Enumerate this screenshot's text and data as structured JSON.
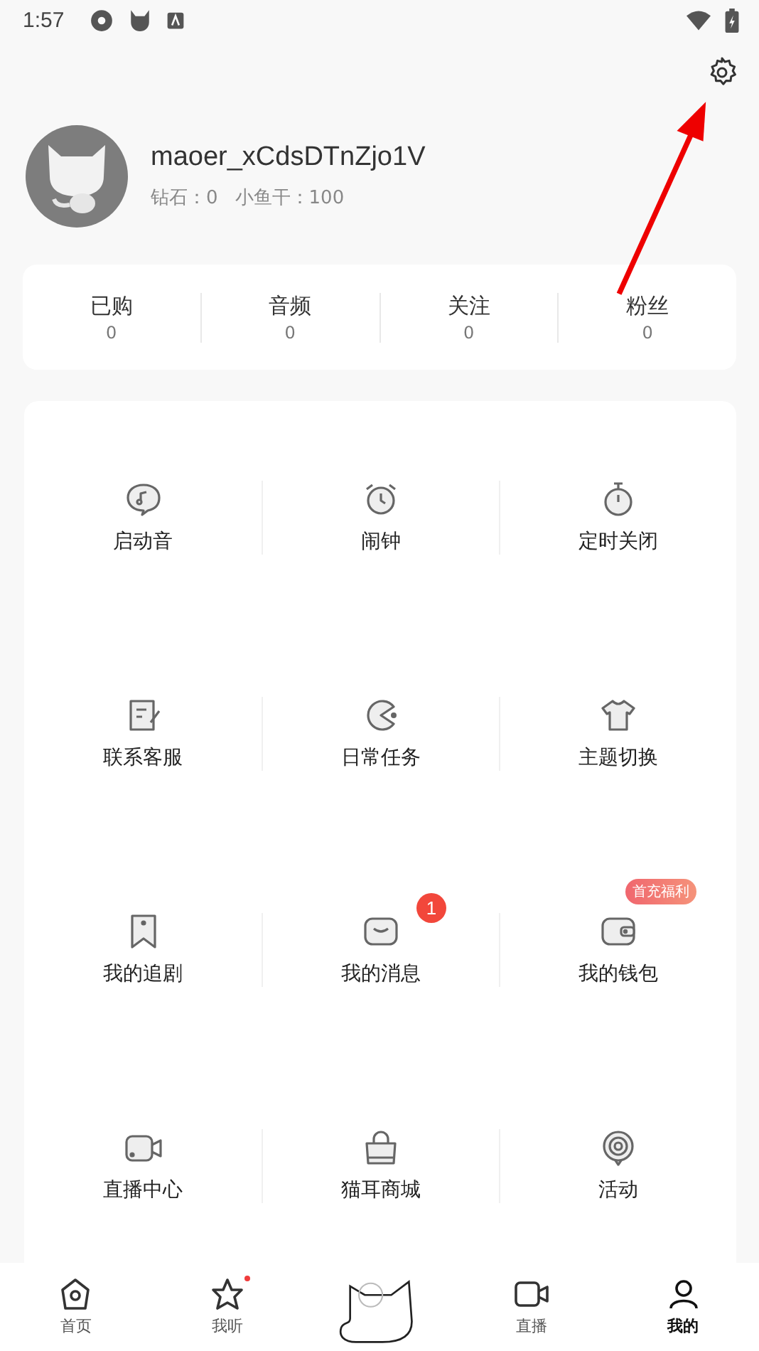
{
  "status_bar": {
    "time": "1:57"
  },
  "profile": {
    "username": "maoer_xCdsDTnZjo1V",
    "stats_line": [
      {
        "label": "钻石：",
        "value": "0"
      },
      {
        "label": "小鱼干：",
        "value": "100"
      }
    ]
  },
  "counters": [
    {
      "label": "已购",
      "value": "0"
    },
    {
      "label": "音频",
      "value": "0"
    },
    {
      "label": "关注",
      "value": "0"
    },
    {
      "label": "粉丝",
      "value": "0"
    }
  ],
  "menu_grid": [
    {
      "label": "启动音"
    },
    {
      "label": "闹钟"
    },
    {
      "label": "定时关闭"
    },
    {
      "label": "联系客服"
    },
    {
      "label": "日常任务"
    },
    {
      "label": "主题切换"
    },
    {
      "label": "我的追剧"
    },
    {
      "label": "我的消息",
      "badge": "1"
    },
    {
      "label": "我的钱包",
      "tag": "首充福利"
    },
    {
      "label": "直播中心"
    },
    {
      "label": "猫耳商城"
    },
    {
      "label": "活动"
    }
  ],
  "bottom_nav": [
    {
      "label": "首页",
      "selected": false,
      "dot": false
    },
    {
      "label": "我听",
      "selected": false,
      "dot": true
    },
    {
      "kind": "center"
    },
    {
      "label": "直播",
      "selected": false,
      "dot": false
    },
    {
      "label": "我的",
      "selected": true,
      "dot": false
    }
  ]
}
